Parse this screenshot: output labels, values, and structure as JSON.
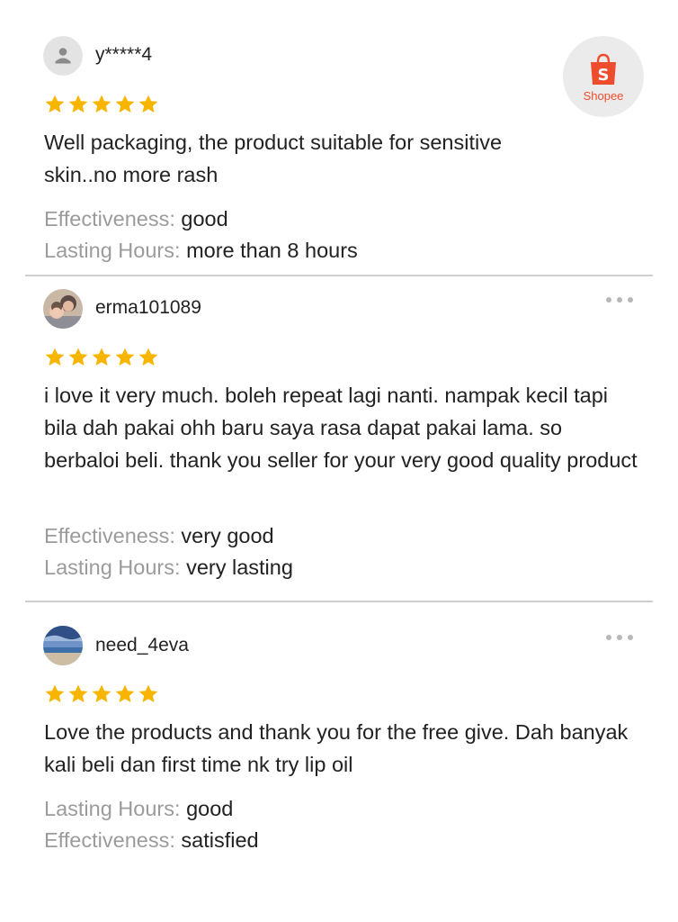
{
  "brand": {
    "name": "Shopee",
    "color": "#ee4d2d",
    "icon": "shopping-bag-icon"
  },
  "star_color": "#f7b500",
  "reviews": [
    {
      "username": "y*****4",
      "avatar": "default-user-icon",
      "rating": 5,
      "text": "Well packaging, the product suitable  for sensitive skin..no more rash",
      "attributes": [
        {
          "key": "Effectiveness:",
          "value": "good"
        },
        {
          "key": "Lasting Hours:",
          "value": "more than 8 hours"
        }
      ]
    },
    {
      "username": "erma101089",
      "avatar": "user-photo",
      "rating": 5,
      "more_icon": "more-options-icon",
      "text": "i love it very much. boleh repeat lagi nanti. nampak kecil tapi bila dah pakai ohh baru saya rasa dapat pakai lama. so berbaloi beli. thank you seller for your very good quality product",
      "attributes": [
        {
          "key": "Effectiveness:",
          "value": "very good"
        },
        {
          "key": "Lasting Hours:",
          "value": "very lasting"
        }
      ]
    },
    {
      "username": "need_4eva",
      "avatar": "user-photo",
      "rating": 5,
      "more_icon": "more-options-icon",
      "text": "Love the products and thank you for the free give.  Dah banyak kali beli dan first time nk try lip oil",
      "attributes": [
        {
          "key": "Lasting Hours:",
          "value": "good"
        },
        {
          "key": "Effectiveness:",
          "value": "satisfied"
        }
      ]
    }
  ]
}
